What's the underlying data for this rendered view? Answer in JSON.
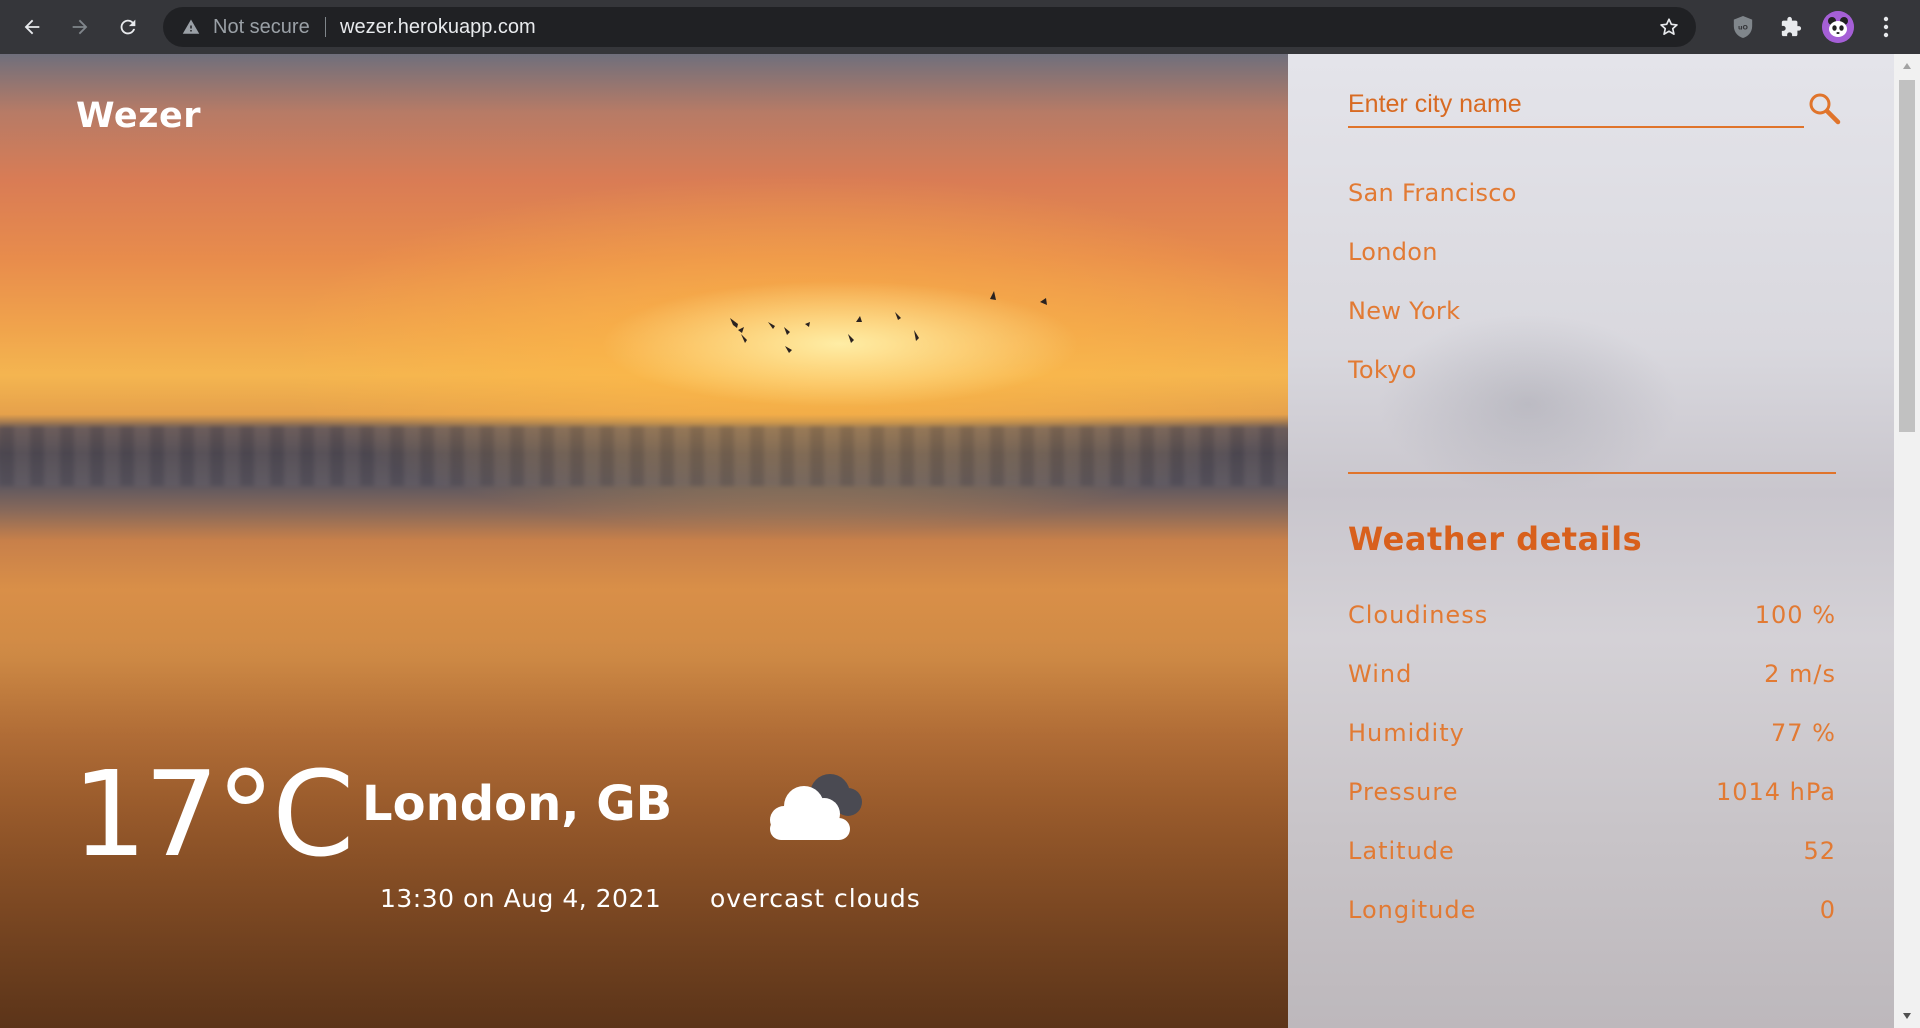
{
  "browser": {
    "security_label": "Not secure",
    "url": "wezer.herokuapp.com",
    "icons": [
      "back-arrow-icon",
      "forward-arrow-icon",
      "reload-icon",
      "warning-icon",
      "star-icon",
      "ublock-icon",
      "puzzle-icon",
      "menu-dots-icon"
    ]
  },
  "app": {
    "brand": "Wezer",
    "current": {
      "temperature": "17°C",
      "location": "London, GB",
      "datetime": "13:30 on Aug 4, 2021",
      "condition": "overcast clouds",
      "condition_icon": "cloud-icon"
    }
  },
  "sidebar": {
    "search": {
      "placeholder": "Enter city name",
      "value": ""
    },
    "cities": [
      "San Francisco",
      "London",
      "New York",
      "Tokyo"
    ],
    "details_title": "Weather details",
    "details": [
      {
        "label": "Cloudiness",
        "value": "100 %"
      },
      {
        "label": "Wind",
        "value": "2 m/s"
      },
      {
        "label": "Humidity",
        "value": "77 %"
      },
      {
        "label": "Pressure",
        "value": "1014 hPa"
      },
      {
        "label": "Latitude",
        "value": "52"
      },
      {
        "label": "Longitude",
        "value": "0"
      }
    ]
  },
  "colors": {
    "accent": "#e0742b",
    "chrome_bg": "#35363a",
    "omnibox_bg": "#202124"
  }
}
